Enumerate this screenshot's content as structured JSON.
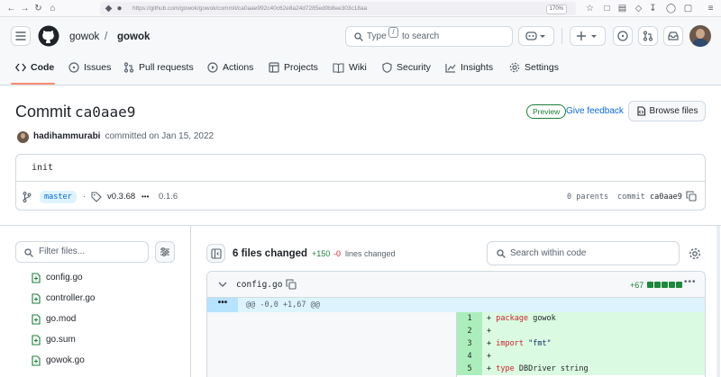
{
  "browser": {
    "url": "https://github.com/gowok/gowok/commit/ca0aae992c40c62e8a24d7285ed0b8ee303c18aa",
    "zoom": "170%"
  },
  "header": {
    "owner": "gowok",
    "separator": "/",
    "repo": "gowok",
    "search_prefix": "Type",
    "search_key": "/",
    "search_suffix": "to search"
  },
  "nav": {
    "tabs": [
      {
        "label": "Code",
        "icon": "code-icon",
        "active": true
      },
      {
        "label": "Issues",
        "icon": "issue-icon"
      },
      {
        "label": "Pull requests",
        "icon": "pull-request-icon"
      },
      {
        "label": "Actions",
        "icon": "play-icon"
      },
      {
        "label": "Projects",
        "icon": "table-icon"
      },
      {
        "label": "Wiki",
        "icon": "book-icon"
      },
      {
        "label": "Security",
        "icon": "shield-icon"
      },
      {
        "label": "Insights",
        "icon": "graph-icon"
      },
      {
        "label": "Settings",
        "icon": "gear-icon"
      }
    ]
  },
  "commit": {
    "title_prefix": "Commit",
    "short_sha": "ca0aae9",
    "preview_label": "Preview",
    "feedback_label": "Give feedback",
    "browse_label": "Browse files",
    "author": "hadihammurabi",
    "committed_text": "committed on Jan 15, 2022",
    "message": "init",
    "branch": "master",
    "tag_version": "v0.3.68",
    "tag_ellipsis": "•••",
    "tag_older": "0.1.6",
    "parents_text": "0 parents",
    "commit_label": "commit",
    "commit_sha": "ca0aae9"
  },
  "files": {
    "filter_placeholder": "Filter files...",
    "items": [
      "config.go",
      "controller.go",
      "go.mod",
      "go.sum",
      "gowok.go"
    ]
  },
  "diff": {
    "files_changed": "6 files changed",
    "additions": "+150",
    "deletions": "-0",
    "lines_changed": "lines changed",
    "search_placeholder": "Search within code",
    "file": {
      "name": "config.go",
      "stat": "+67",
      "hunk": "@@ -0,0 +1,67 @@",
      "lines": [
        {
          "n": "1",
          "sign": "+ ",
          "kw": "package",
          "rest": " gowok"
        },
        {
          "n": "2",
          "sign": "+",
          "kw": "",
          "rest": ""
        },
        {
          "n": "3",
          "sign": "+ ",
          "kw": "import",
          "rest": " \"fmt\""
        },
        {
          "n": "4",
          "sign": "+",
          "kw": "",
          "rest": ""
        },
        {
          "n": "5",
          "sign": "+ ",
          "kw": "type",
          "rest": " DBDriver string"
        }
      ]
    }
  }
}
